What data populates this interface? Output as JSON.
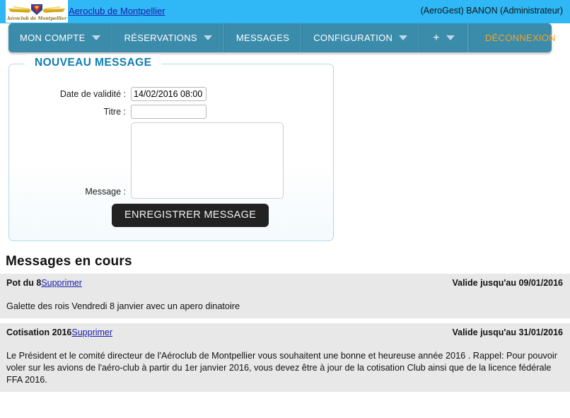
{
  "header": {
    "logo_alt": "Aeroclub de Montpellier",
    "logo_script_text": "Aéroclub de Montpellier",
    "site_link": "Aeroclub de Montpellier",
    "user_info": "(AeroGest) BANON (Administrateur)",
    "bg_color": "#2fb8f5"
  },
  "nav": {
    "bg_color": "#3b8bab",
    "logout_color": "#f5a623",
    "items": [
      {
        "label": "MON COMPTE",
        "has_caret": true
      },
      {
        "label": "RÉSERVATIONS",
        "has_caret": true
      },
      {
        "label": "MESSAGES",
        "has_caret": false
      },
      {
        "label": "CONFIGURATION",
        "has_caret": true
      },
      {
        "label": "+",
        "has_caret": true
      }
    ],
    "logout_label": "DÉCONNEXION"
  },
  "form": {
    "legend": "NOUVEAU MESSAGE",
    "legend_color": "#0e7eb0",
    "date_label": "Date de validité :",
    "date_value": "14/02/2016 08:00",
    "date_placeholder": "",
    "title_label": "Titre :",
    "title_value": "",
    "title_placeholder": "",
    "message_label": "Message :",
    "message_value": "",
    "message_placeholder": "",
    "save_label": "ENREGISTRER MESSAGE"
  },
  "messages": {
    "section_title": "Messages en cours",
    "delete_label": "Supprimer",
    "items": [
      {
        "title": "Pot du 8",
        "delete_label": "Supprimer",
        "valid_until": "Valide jusqu'au 09/01/2016",
        "body": "Galette des rois Vendredi 8 janvier avec un apero dinatoire"
      },
      {
        "title": "Cotisation 2016",
        "delete_label": "Supprimer",
        "valid_until": "Valide jusqu'au 31/01/2016",
        "body": "Le Président et le comité directeur de l'Aéroclub de Montpellier vous souhaitent une bonne et heureuse année 2016 . Rappel: Pour pouvoir voler sur les avions de l'aéro-club à partir du 1er janvier 2016, vous devez être à jour de la cotisation Club ainsi que de la licence fédérale FFA 2016."
      }
    ]
  }
}
